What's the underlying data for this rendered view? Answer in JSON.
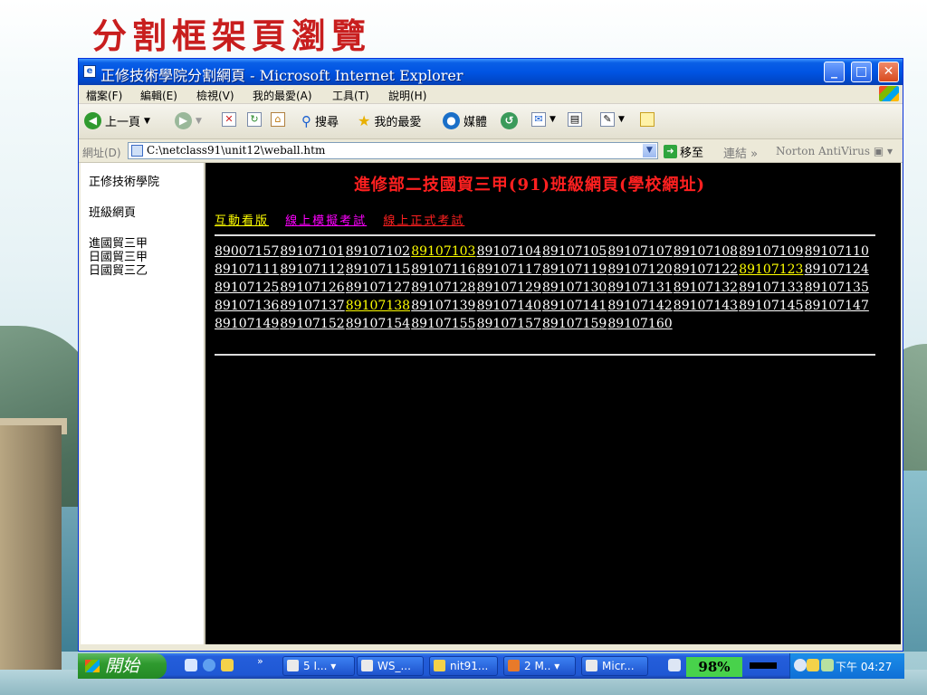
{
  "slide": {
    "title": "分割框架頁瀏覽"
  },
  "window": {
    "title": "正修技術學院分割網頁 - Microsoft Internet Explorer"
  },
  "menu": [
    "檔案(F)",
    "編輯(E)",
    "檢視(V)",
    "我的最愛(A)",
    "工具(T)",
    "說明(H)"
  ],
  "toolbar": {
    "back": "上一頁",
    "search": "搜尋",
    "favorites": "我的最愛",
    "media": "媒體"
  },
  "address": {
    "label": "網址(D)",
    "value": "C:\\netclass91\\unit12\\weball.htm",
    "go": "移至",
    "links": "連結",
    "norton": "Norton AntiVirus"
  },
  "left_frame": {
    "items": [
      "正修技術學院",
      "班級網頁",
      "進國貿三甲",
      "日國貿三甲",
      "日國貿三乙"
    ]
  },
  "main_frame": {
    "heading": "進修部二技國貿三甲(91)班級網頁(學校網址)",
    "tabs": [
      {
        "label": "互動看版",
        "color": "#ffff00"
      },
      {
        "label": "線上模擬考試",
        "color": "#ff00ff"
      },
      {
        "label": "線上正式考試",
        "color": "#ff2020"
      }
    ],
    "student_ids": [
      [
        "89007157",
        "89107101",
        "89107102",
        "89107103",
        "89107104",
        "89107105",
        "89107107",
        "89107108",
        "89107109",
        "89107110"
      ],
      [
        "89107111",
        "89107112",
        "89107115",
        "89107116",
        "89107117",
        "89107119",
        "89107120",
        "89107122",
        "89107123",
        "89107124"
      ],
      [
        "89107125",
        "89107126",
        "89107127",
        "89107128",
        "89107129",
        "89107130",
        "89107131",
        "89107132",
        "89107133",
        "89107135"
      ],
      [
        "89107136",
        "89107137",
        "89107138",
        "89107139",
        "89107140",
        "89107141",
        "89107142",
        "89107143",
        "89107145",
        "89107147"
      ],
      [
        "89107149",
        "89107152",
        "89107154",
        "89107155",
        "89107157",
        "89107159",
        "89107160"
      ]
    ],
    "highlighted_ids": [
      "89107103",
      "89107123",
      "89107138"
    ],
    "highlight_color": "#ffff00"
  },
  "taskbar": {
    "start": "開始",
    "tasks": [
      "5 I...",
      "WS_...",
      "nit91...",
      "2 M..",
      "Micr..."
    ],
    "battery": "98%",
    "clock": "下午 04:27"
  }
}
